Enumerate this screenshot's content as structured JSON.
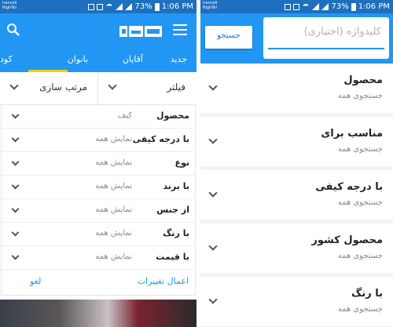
{
  "status": {
    "carrier1": "Irancell",
    "carrier2": "RighTel",
    "battery": "73%",
    "time": "1:06 PM"
  },
  "left": {
    "tabs": [
      "جدید",
      "آقایان",
      "بانوان",
      "کود"
    ],
    "active_tab": "بانوان",
    "filter_label": "فیلتر",
    "sort_label": "مرتب سازی",
    "filters": [
      {
        "name": "محصول",
        "value": "کیف"
      },
      {
        "name": "با درجه کیفی",
        "value": "نمایش همه"
      },
      {
        "name": "نوع",
        "value": "نمایش همه"
      },
      {
        "name": "با برند",
        "value": "نمایش همه"
      },
      {
        "name": "از جنس",
        "value": "نمایش همه"
      },
      {
        "name": "با رنگ",
        "value": "نمایش همه"
      },
      {
        "name": "با قیمت",
        "value": "نمایش همه"
      }
    ],
    "apply_label": "اعمال تغییرات",
    "cancel_label": "لغو"
  },
  "right": {
    "search_placeholder": "کلیدواژه (اختیاری)",
    "search_button": "جستجو",
    "facets": [
      {
        "title": "محصول",
        "subtitle": "جستجوی همه"
      },
      {
        "title": "مناسب برای",
        "subtitle": "جستجوی همه"
      },
      {
        "title": "با درجه کیفی",
        "subtitle": "جستجوی همه"
      },
      {
        "title": "محصول کشور",
        "subtitle": "جستجوی همه"
      },
      {
        "title": "با رنگ",
        "subtitle": "جستجوی همه"
      }
    ]
  },
  "colors": {
    "primary": "#2196f3",
    "status_bar": "#1d6fbf",
    "tab_indicator": "#ffcc00"
  }
}
